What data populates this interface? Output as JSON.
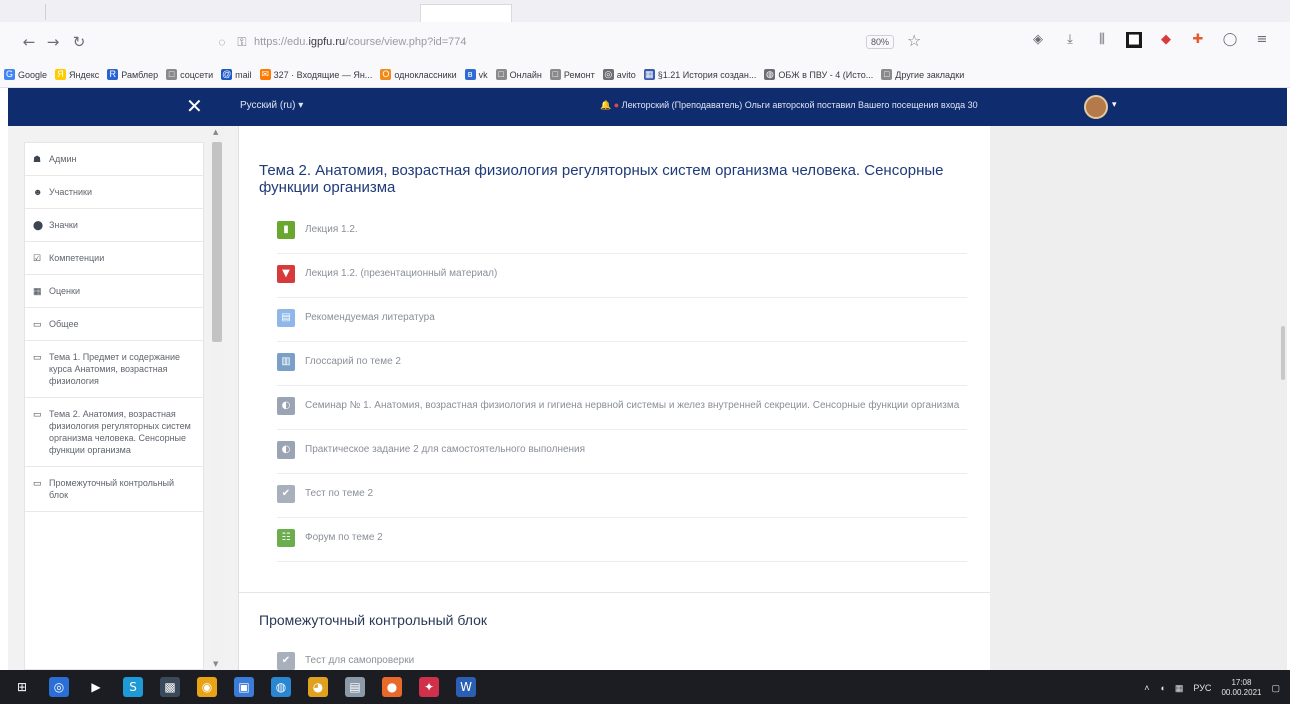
{
  "browser": {
    "url_prefix": "https://edu.",
    "url_host": "igpfu.ru",
    "url_rest": "/course/view.php?id=774",
    "zoom": "80%",
    "bookmarks": [
      {
        "label": "Google",
        "color": "#4285f4",
        "icon": "G"
      },
      {
        "label": "Яндекс",
        "color": "#ffcc00",
        "icon": "Я"
      },
      {
        "label": "Рамблер",
        "color": "#2a63d4",
        "icon": "R"
      },
      {
        "label": "соцсети",
        "color": "#8a8a8a",
        "icon": "□"
      },
      {
        "label": "mail",
        "color": "#1e58c6",
        "icon": "@"
      },
      {
        "label": "327 · Входящие — Ян...",
        "color": "#ff7a00",
        "icon": "✉"
      },
      {
        "label": "одноклассники",
        "color": "#f28a17",
        "icon": "О"
      },
      {
        "label": "vk",
        "color": "#2f6bd0",
        "icon": "в"
      },
      {
        "label": "Онлайн",
        "color": "#8a8a8a",
        "icon": "□"
      },
      {
        "label": "Ремонт",
        "color": "#8a8a8a",
        "icon": "□"
      },
      {
        "label": "avito",
        "color": "#6d6d75",
        "icon": "◎"
      },
      {
        "label": "§1.21 История создан...",
        "color": "#3a5cb0",
        "icon": "▦"
      },
      {
        "label": "ОБЖ в ПВУ - 4 (Исто...",
        "color": "#6d6d75",
        "icon": "◍"
      },
      {
        "label": "Другие закладки",
        "color": "#8a8a8a",
        "icon": "□"
      }
    ]
  },
  "moodle_nav": {
    "language": "Русский (ru) ▾",
    "notification": "Лекторский (Преподаватель) Ольги авторской поставил Вашего посещения входа 30"
  },
  "drawer": {
    "items": [
      {
        "icon": "☗",
        "label": "Админ"
      },
      {
        "icon": "☻",
        "label": "Участники"
      },
      {
        "icon": "⬤",
        "label": "Значки"
      },
      {
        "icon": "☑",
        "label": "Компетенции"
      },
      {
        "icon": "▦",
        "label": "Оценки"
      },
      {
        "icon": "▭",
        "label": "Общее"
      },
      {
        "icon": "▭",
        "label": "Тема 1. Предмет и содержание курса Анатомия, возрастная физиология"
      },
      {
        "icon": "▭",
        "label": "Тема 2. Анатомия, возрастная физиология регуляторных систем организма человека. Сенсорные функции организма"
      },
      {
        "icon": "▭",
        "label": "Промежуточный контрольный блок"
      }
    ]
  },
  "main": {
    "section_title": "Тема 2. Анатомия, возрастная физиология регуляторных систем организма человека. Сенсорные функции организма",
    "activities": [
      {
        "icon": "▮",
        "color": "#6aa72e",
        "label": "Лекция 1.2."
      },
      {
        "icon": "▼",
        "color": "#d63a3a",
        "label": "Лекция 1.2. (презентационный материал)"
      },
      {
        "icon": "▤",
        "color": "#8fb8e8",
        "label": "Рекомендуемая литература"
      },
      {
        "icon": "▥",
        "color": "#7aa0c8",
        "label": "Глоссарий по теме 2"
      },
      {
        "icon": "◐",
        "color": "#9aa4b4",
        "label": "Семинар № 1. Анатомия, возрастная физиология и гигиена нервной системы и желез внутренней секреции. Сенсорные функции организма"
      },
      {
        "icon": "◐",
        "color": "#9aa4b4",
        "label": "Практическое задание 2 для самостоятельного выполнения"
      },
      {
        "icon": "✔",
        "color": "#a8b0bc",
        "label": "Тест по теме 2"
      },
      {
        "icon": "☷",
        "color": "#6cae4e",
        "label": "Форум по теме 2"
      }
    ],
    "section2_title": "Промежуточный контрольный блок",
    "section2_first": {
      "icon": "✔",
      "color": "#a8b0bc",
      "label": "Тест для самопроверки"
    }
  },
  "taskbar": {
    "lang": "РУС",
    "time": "17:08",
    "date": "00.00.2021",
    "apps": [
      {
        "icon": "⊞",
        "color": "#1c1d22"
      },
      {
        "icon": "◎",
        "color": "#2b6fd6"
      },
      {
        "icon": "▶",
        "color": "#1c1d22"
      },
      {
        "icon": "S",
        "color": "#1e9bd7"
      },
      {
        "icon": "▩",
        "color": "#3a4a5a"
      },
      {
        "icon": "◉",
        "color": "#e8a317"
      },
      {
        "icon": "▣",
        "color": "#3b7cd8"
      },
      {
        "icon": "◍",
        "color": "#2a86d0"
      },
      {
        "icon": "◕",
        "color": "#e0a020"
      },
      {
        "icon": "▤",
        "color": "#8a9aa8"
      },
      {
        "icon": "●",
        "color": "#e86a2a"
      },
      {
        "icon": "✦",
        "color": "#d0304a"
      },
      {
        "icon": "W",
        "color": "#2b5fb4"
      }
    ]
  }
}
